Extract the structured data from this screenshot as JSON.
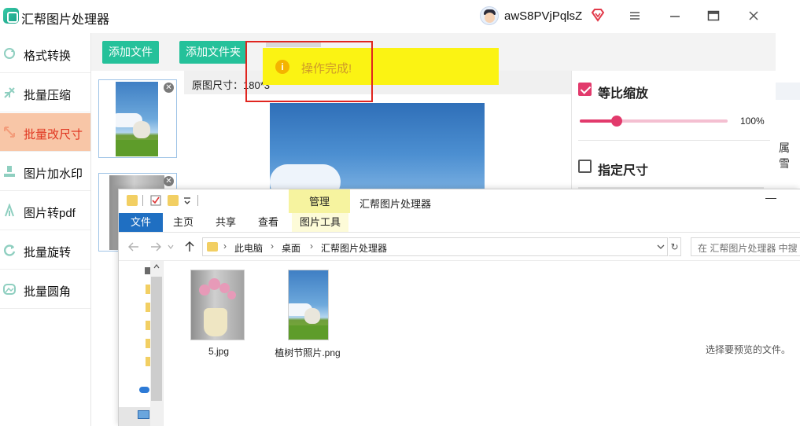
{
  "app": {
    "title": "汇帮图片处理器",
    "username": "awS8PVjPqlsZ"
  },
  "colors": {
    "accent_green": "#25c19a",
    "active_bg": "#f8c6a7",
    "active_text": "#e0351f",
    "checkbox_pink": "#e23a6c",
    "toast_bg": "#fbf313",
    "toast_text": "#ce9a2a",
    "highlight_red": "#e0251f"
  },
  "sidebar": {
    "items": [
      {
        "label": "格式转换",
        "icon": "format-convert-icon",
        "active": false
      },
      {
        "label": "批量压缩",
        "icon": "compress-icon",
        "active": false
      },
      {
        "label": "批量改尺寸",
        "icon": "resize-icon",
        "active": true
      },
      {
        "label": "图片加水印",
        "icon": "watermark-icon",
        "active": false
      },
      {
        "label": "图片转pdf",
        "icon": "pdf-icon",
        "active": false
      },
      {
        "label": "批量旋转",
        "icon": "rotate-icon",
        "active": false
      },
      {
        "label": "批量圆角",
        "icon": "round-corner-icon",
        "active": false
      }
    ]
  },
  "toolbar": {
    "add_file": "添加文件",
    "add_folder": "添加文件夹"
  },
  "preview": {
    "original_size_label": "原图尺寸：180*3"
  },
  "toast": {
    "message": "操作完成!"
  },
  "right_panel": {
    "scale_label": "等比缩放",
    "scale_checked": true,
    "scale_value_text": "100%",
    "scale_fraction": 0.25,
    "size_label": "指定尺寸",
    "size_checked": false,
    "partial_text": "属雪"
  },
  "explorer": {
    "manage_tab": "管理",
    "window_title": "汇帮图片处理器",
    "minimize": "—",
    "tabs": {
      "file": "文件",
      "home": "主页",
      "share": "共享",
      "view": "查看",
      "picture_tools": "图片工具"
    },
    "breadcrumb": [
      "此电脑",
      "桌面",
      "汇帮图片处理器"
    ],
    "search_placeholder": "在 汇帮图片处理器 中搜",
    "files": [
      {
        "name": "5.jpg"
      },
      {
        "name": "植树节照片.png"
      }
    ],
    "preview_message": "选择要预览的文件。"
  }
}
